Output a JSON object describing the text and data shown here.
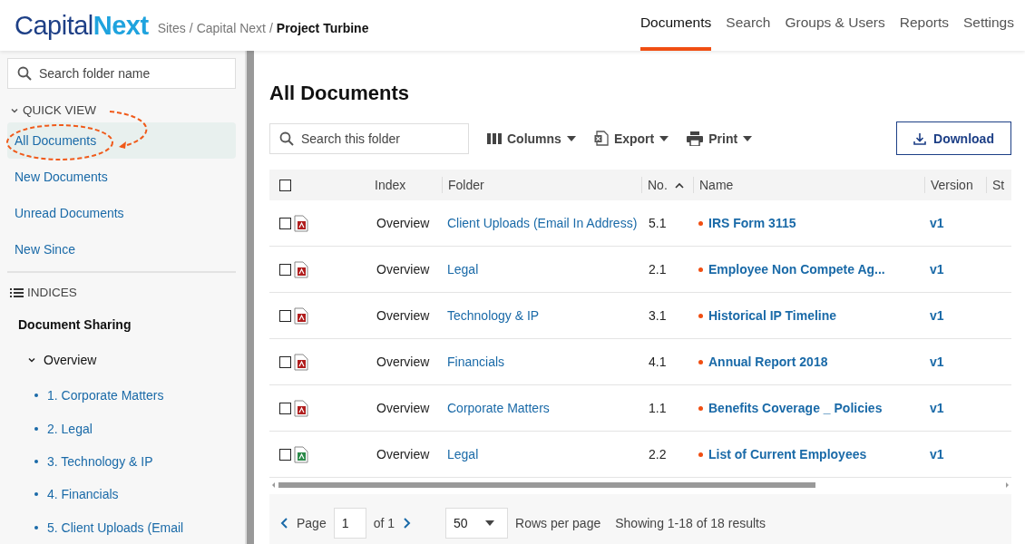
{
  "logo": {
    "part_1": "Capital",
    "part_2": "Next"
  },
  "breadcrumb": {
    "items": [
      {
        "label": "Sites",
        "current": false
      },
      {
        "label": "Capital Next",
        "current": false
      },
      {
        "label": "Project Turbine",
        "current": true
      }
    ],
    "separators": [
      "/",
      "/"
    ]
  },
  "nav": [
    {
      "label": "Documents",
      "selected": true
    },
    {
      "label": "Search",
      "selected": false
    },
    {
      "label": "Groups & Users",
      "selected": false
    },
    {
      "label": "Reports",
      "selected": false
    },
    {
      "label": "Settings",
      "selected": false
    }
  ],
  "sidebar": {
    "search": {
      "placeholder": "Search folder name"
    },
    "quick_view": {
      "title": "QUICK VIEW",
      "expanded": true,
      "items": [
        {
          "label": "All Documents",
          "selected": true
        },
        {
          "label": "New Documents",
          "selected": false
        },
        {
          "label": "Unread Documents",
          "selected": false
        },
        {
          "label": "New Since",
          "selected": false
        }
      ]
    },
    "indices": {
      "title": "INDICES",
      "tree": [
        {
          "label": "Document Sharing",
          "children": [
            {
              "label": "Overview",
              "expanded": true,
              "children": [
                {
                  "label": "1. Corporate Matters"
                },
                {
                  "label": "2. Legal"
                },
                {
                  "label": "3. Technology & IP"
                },
                {
                  "label": "4. Financials"
                },
                {
                  "label": "5. Client Uploads (Email"
                }
              ]
            }
          ]
        }
      ]
    }
  },
  "main": {
    "title": "All Documents",
    "search": {
      "placeholder": "Search this folder"
    },
    "toolbar": [
      {
        "label": "Columns",
        "kind": "columns"
      },
      {
        "label": "Export",
        "kind": "export"
      },
      {
        "label": "Print",
        "kind": "print"
      }
    ],
    "download": "Download",
    "table": {
      "select_all": false,
      "columns": [
        {
          "label": "Index",
          "sorted": false
        },
        {
          "label": "Folder",
          "sorted": false
        },
        {
          "label": "No.",
          "sorted": true
        },
        {
          "label": "Name",
          "sorted": false
        },
        {
          "label": "Version",
          "sorted": false
        },
        {
          "label": "St",
          "sorted": false
        }
      ],
      "rows": [
        {
          "checked": false,
          "kind": "pdf",
          "index": "Overview",
          "folder": "Client Uploads (Email In Address)",
          "no": "5.1",
          "unread": true,
          "name": "IRS Form 3115",
          "version": "v1"
        },
        {
          "checked": false,
          "kind": "pdf",
          "index": "Overview",
          "folder": "Legal",
          "no": "2.1",
          "unread": true,
          "name": "Employee Non Compete Ag...",
          "version": "v1"
        },
        {
          "checked": false,
          "kind": "pdf",
          "index": "Overview",
          "folder": "Technology & IP",
          "no": "3.1",
          "unread": true,
          "name": "Historical IP Timeline",
          "version": "v1"
        },
        {
          "checked": false,
          "kind": "pdf",
          "index": "Overview",
          "folder": "Financials",
          "no": "4.1",
          "unread": true,
          "name": "Annual Report 2018",
          "version": "v1"
        },
        {
          "checked": false,
          "kind": "pdf",
          "index": "Overview",
          "folder": "Corporate Matters",
          "no": "1.1",
          "unread": true,
          "name": "Benefits Coverage _ Policies",
          "version": "v1"
        },
        {
          "checked": false,
          "kind": "excel",
          "index": "Overview",
          "folder": "Legal",
          "no": "2.2",
          "unread": true,
          "name": "List of Current Employees",
          "version": "v1"
        }
      ]
    },
    "pagination": {
      "page_label": "Page",
      "page": "1",
      "of": "of 1",
      "rows_per_page": "50",
      "rows_label": "Rows per page",
      "summary": "Showing 1-18 of 18 results"
    }
  }
}
